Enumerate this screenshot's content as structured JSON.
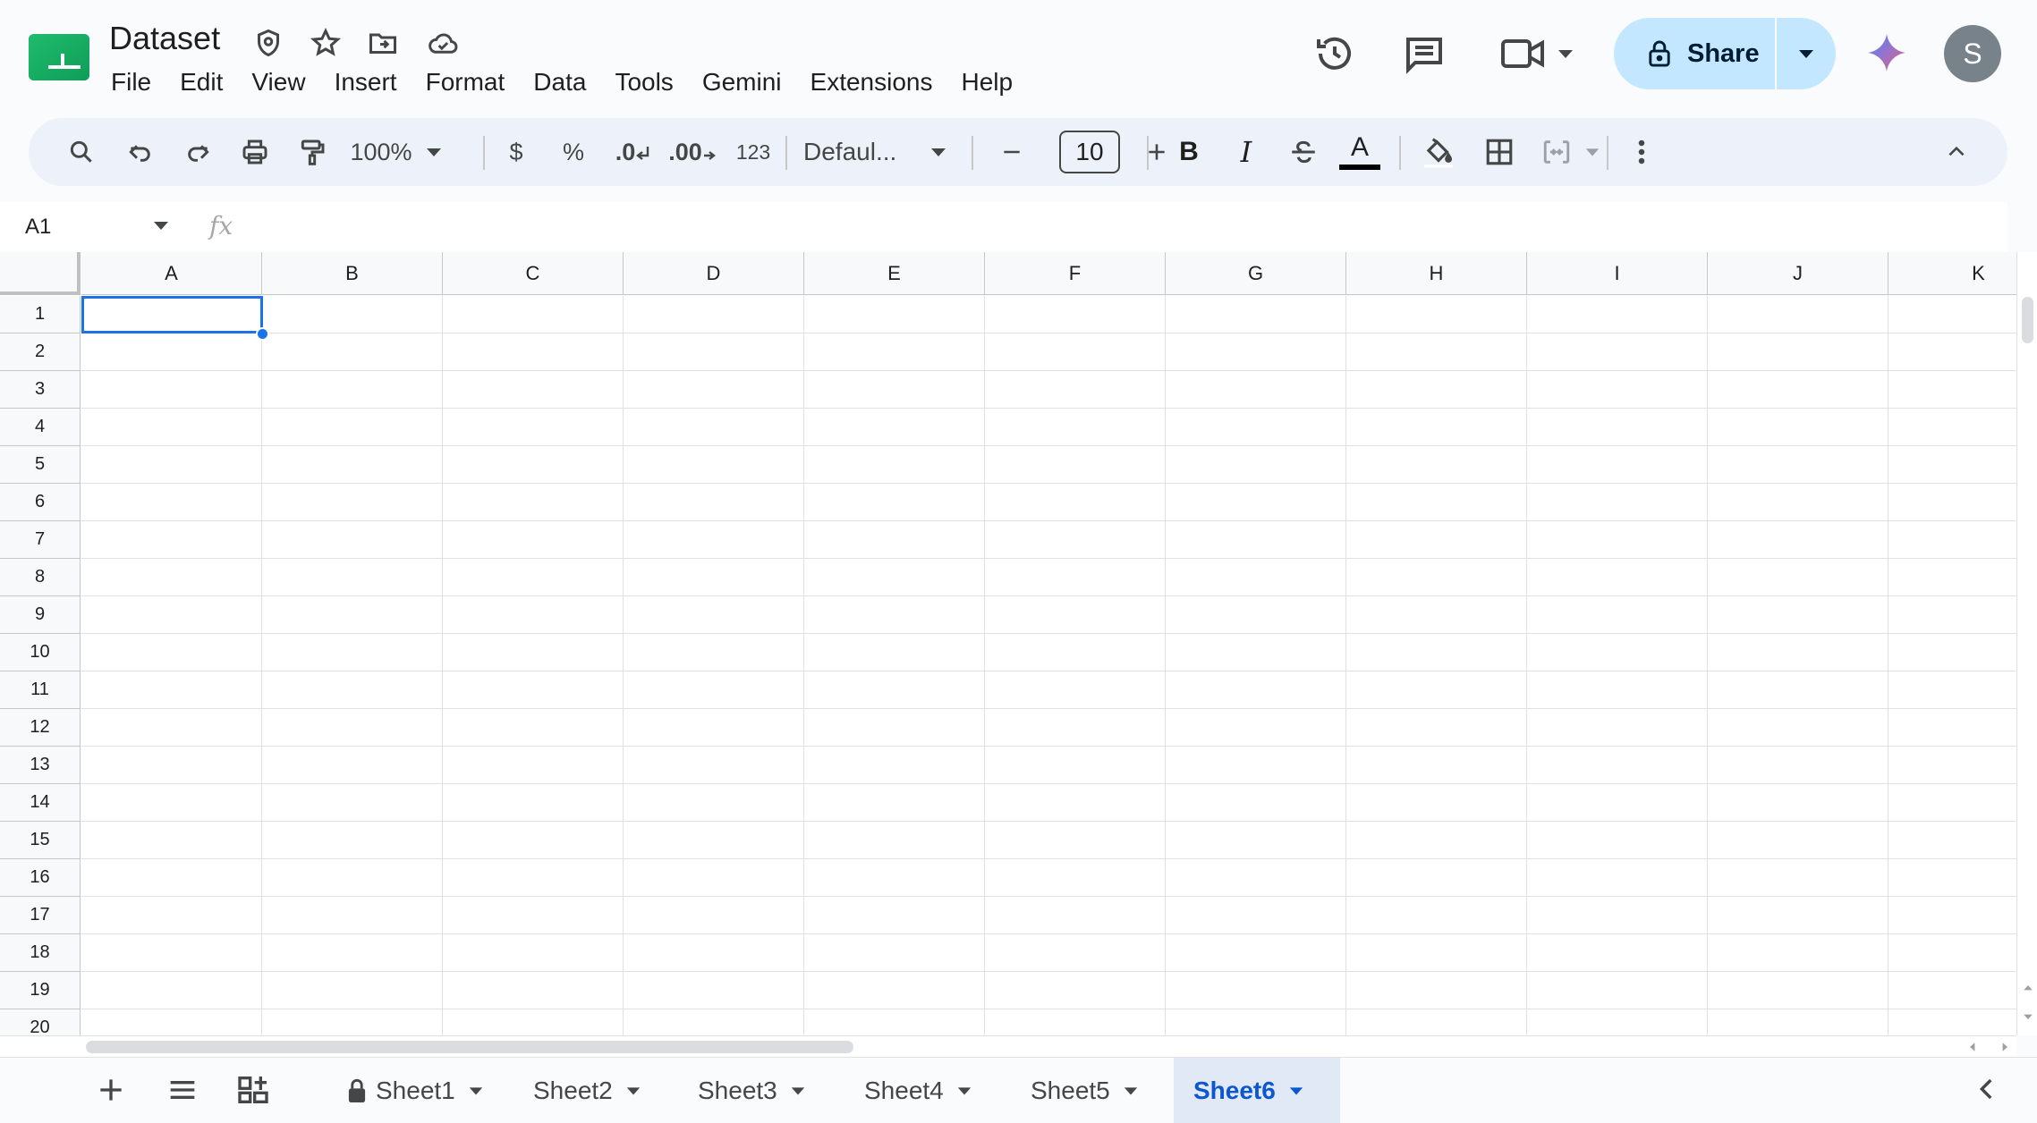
{
  "document": {
    "title": "Dataset"
  },
  "menu": [
    "File",
    "Edit",
    "View",
    "Insert",
    "Format",
    "Data",
    "Tools",
    "Gemini",
    "Extensions",
    "Help"
  ],
  "share": {
    "label": "Share"
  },
  "user": {
    "initial": "S"
  },
  "toolbar": {
    "zoom": "100%",
    "currency": "$",
    "percent": "%",
    "dec_decrease": ".0",
    "dec_increase": ".00",
    "number_format": "123",
    "font_family": "Defaul...",
    "font_size": "10",
    "bold": "B",
    "italic": "I",
    "text_color_letter": "A"
  },
  "formula_bar": {
    "cell_ref": "A1",
    "fx": "fx",
    "content": ""
  },
  "grid": {
    "columns": [
      "A",
      "B",
      "C",
      "D",
      "E",
      "F",
      "G",
      "H",
      "I",
      "J",
      "K"
    ],
    "rows": [
      "1",
      "2",
      "3",
      "4",
      "5",
      "6",
      "7",
      "8",
      "9",
      "10",
      "11",
      "12",
      "13",
      "14",
      "15",
      "16",
      "17",
      "18",
      "19",
      "20"
    ],
    "selected_cell": "A1"
  },
  "sheets": [
    {
      "name": "Sheet1",
      "locked": true,
      "active": false
    },
    {
      "name": "Sheet2",
      "locked": false,
      "active": false
    },
    {
      "name": "Sheet3",
      "locked": false,
      "active": false
    },
    {
      "name": "Sheet4",
      "locked": false,
      "active": false
    },
    {
      "name": "Sheet5",
      "locked": false,
      "active": false
    },
    {
      "name": "Sheet6",
      "locked": false,
      "active": true
    }
  ],
  "colors": {
    "accent": "#1a73e8",
    "share_bg": "#c2e7ff",
    "app_bg": "#f9fbfd",
    "toolbar_bg": "#edf2fa"
  }
}
